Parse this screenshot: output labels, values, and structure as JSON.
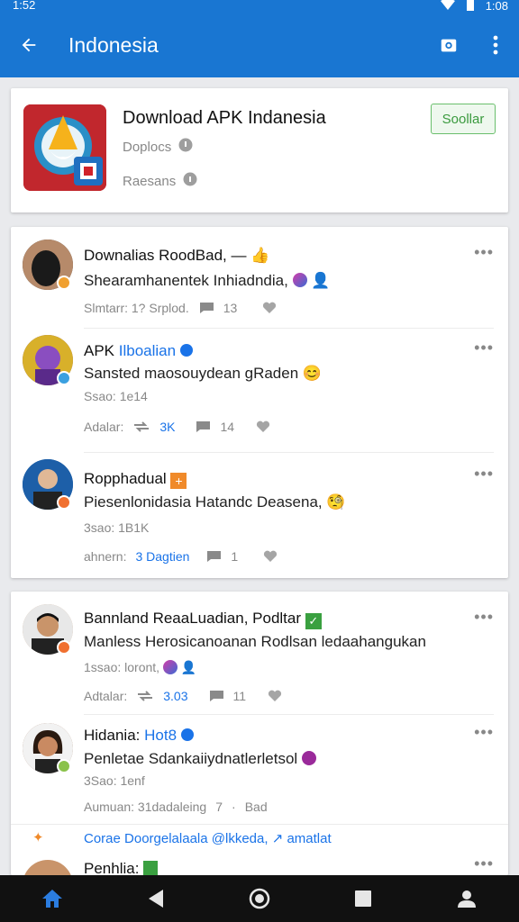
{
  "status_bar": {
    "time_left": "1:52",
    "time_right": "1:08"
  },
  "app_bar": {
    "title": "Indonesia",
    "icons": [
      "back-arrow-icon",
      "camera-icon",
      "more-vert-icon"
    ]
  },
  "app": {
    "title": "Download APK Indanesia",
    "meta1": "Doplocs",
    "meta2": "Raesans",
    "install_label": "Soollar"
  },
  "posts": [
    {
      "name": "Downalias RoodBad, —",
      "text": "Shearamhanentek Inhiadndia,",
      "sub": "",
      "actions_label": "Slmtarr: 1? Srplod.",
      "count1": "",
      "count2": "13",
      "avatar_color": "#3a3a3a",
      "badge_color": "#f0a030"
    },
    {
      "name": "APK",
      "name_tag": "Ilboalian",
      "text": "Sansted maosouydean gRaden",
      "sub": "Ssao: 1e14",
      "actions_label": "Adalar:",
      "count1": "3K",
      "count2": "14",
      "avatar_color": "#7a4aa0",
      "badge_color": "#3aa0e0"
    },
    {
      "name": "Ropphadual",
      "text": "Piesenlonidasia Hatandc Deasena,",
      "sub": "3sao: 1B1K",
      "actions_label": "ahnern:",
      "actions_tag": "3 Dagtien",
      "count1": "",
      "count2": "1",
      "avatar_color": "#1d5fa8",
      "badge_color": "#f07030"
    },
    {
      "name": "Bannland ReaaLuadian, Podltar",
      "text": "Manless Herosicanoanan Rodlsan ledaahangukan",
      "sub": "1ssao: loront,",
      "actions_label": "Adtalar:",
      "count1": "3.03",
      "count2": "11",
      "avatar_color": "#c9a07a",
      "badge_color": "#f07030"
    },
    {
      "name": "Hidania:",
      "name_tag": "Hot8",
      "text": "Penletae Sdankaiiydnatlerletsol",
      "sub": "3Sao: 1enf",
      "actions_label": "Aumuan: 31dadaleing",
      "count1": "7",
      "count2": "Bad",
      "avatar_color": "#8a5a3a",
      "badge_color": "#8ac24a"
    }
  ],
  "footer_link": "Corae Doorgelalaala @lkkeda,",
  "footer_link_tail": "amatlat",
  "partial_post_name": "Penhlia:",
  "nav": [
    "home-icon",
    "back-triangle-icon",
    "home-circle-icon",
    "recents-square-icon",
    "profile-icon"
  ],
  "colors": {
    "primary": "#1976d2",
    "accent_green": "#3a9a3e",
    "link_blue": "#1a73e8"
  }
}
